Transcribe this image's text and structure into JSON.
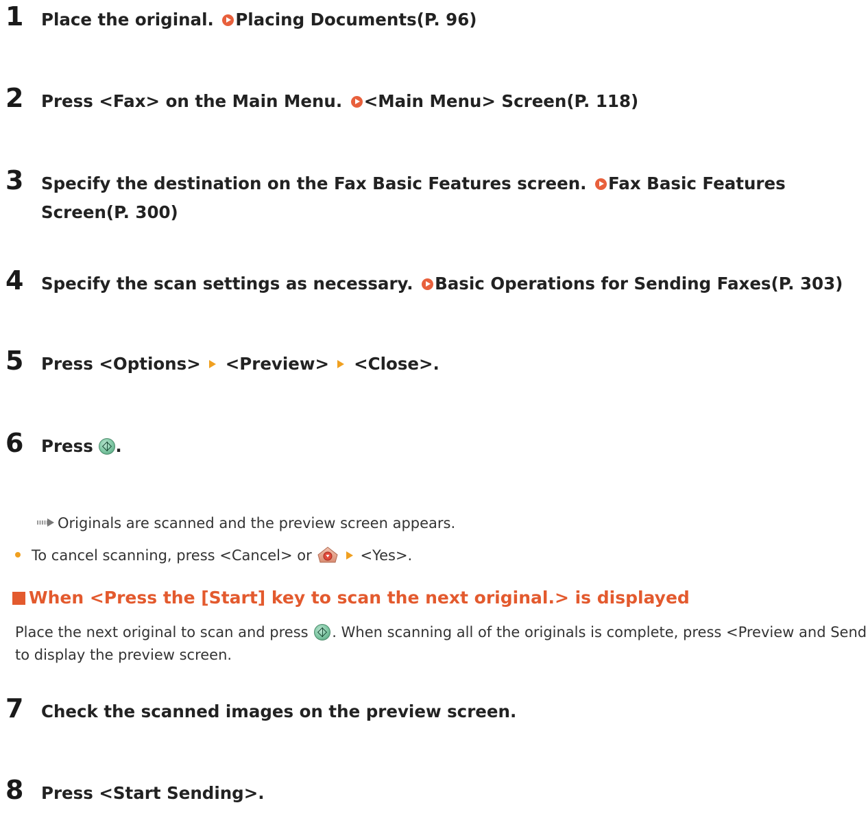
{
  "steps": [
    {
      "num": "1",
      "text": "Place the original.",
      "link": "Placing Documents(P. 96)"
    },
    {
      "num": "2",
      "text": "Press <Fax> on the Main Menu.",
      "link": "<Main Menu> Screen(P. 118)"
    },
    {
      "num": "3",
      "text": "Specify the destination on the Fax Basic Features screen.",
      "link": "Fax Basic Features Screen(P. 300)"
    },
    {
      "num": "4",
      "text": "Specify the scan settings as necessary.",
      "link": "Basic Operations for Sending Faxes(P. 303)"
    },
    {
      "num": "5",
      "part1": "Press <Options>",
      "part2": "<Preview>",
      "part3": "<Close>."
    },
    {
      "num": "6",
      "pre": "Press",
      "post": "."
    },
    {
      "num": "7",
      "text": "Check the scanned images on the preview screen."
    },
    {
      "num": "8",
      "text": "Press <Start Sending>."
    }
  ],
  "result": "Originals are scanned and the preview screen appears.",
  "bullet": {
    "pre": "To cancel scanning, press <Cancel> or",
    "post": "<Yes>."
  },
  "subheading": "When <Press the [Start] key to scan the next original.> is displayed",
  "paragraph": {
    "pre": "Place the next original to scan and press",
    "post": ". When scanning all of the originals is complete, press <Preview and Send> to display the preview screen."
  },
  "icons": {
    "link": "link-arrow-icon",
    "separator": "menu-arrow-icon",
    "start": "start-key-icon",
    "stop": "stop-key-icon",
    "result": "result-arrow-icon"
  },
  "colors": {
    "accent": "#e35a2e",
    "link_icon": "#e8603c",
    "separator": "#f0a020",
    "start_key": "#7cc6a2"
  }
}
